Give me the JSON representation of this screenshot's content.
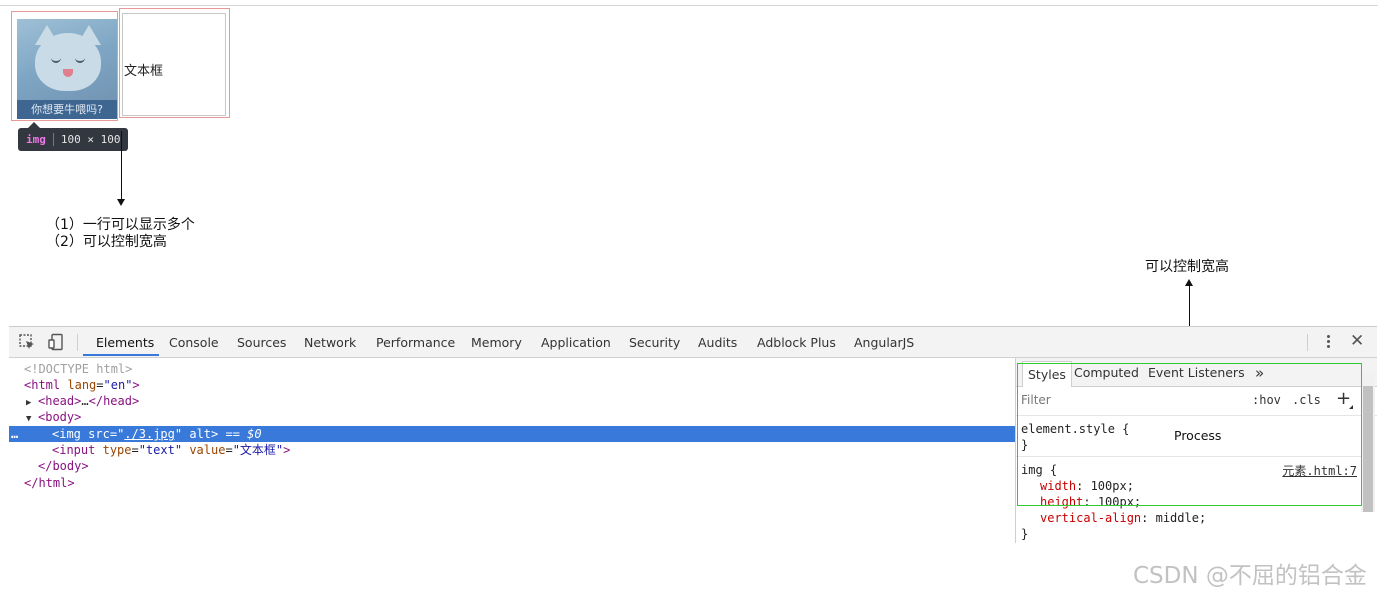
{
  "preview": {
    "image_caption": "你想要牛喂吗?",
    "input_value": "文本框",
    "tooltip_tag": "img",
    "tooltip_size": "100 × 100"
  },
  "notes": {
    "line1": "（1）一行可以显示多个",
    "line2": "（2）可以控制宽高",
    "right_label": "可以控制宽高",
    "process_label": "Process"
  },
  "devtools": {
    "tabs": [
      "Elements",
      "Console",
      "Sources",
      "Network",
      "Performance",
      "Memory",
      "Application",
      "Security",
      "Audits",
      "Adblock Plus",
      "AngularJS"
    ],
    "active_tab": "Elements",
    "dom": {
      "doctype": "<!DOCTYPE html>",
      "html_open_tag": "html",
      "html_lang_attr": "lang",
      "html_lang_val": "\"en\"",
      "head_tag": "head",
      "head_ellipsis": "…",
      "body_tag": "body",
      "img_tag": "img",
      "img_src_attr": "src",
      "img_src_val": "./3.jpg",
      "img_alt_attr": "alt",
      "img_selected_marker": "== $0",
      "input_tag": "input",
      "input_type_attr": "type",
      "input_type_val": "\"text\"",
      "input_value_attr": "value",
      "input_value_val": "\"文本框\"",
      "row_dots": "…"
    },
    "styles": {
      "sub_tabs": [
        "Styles",
        "Computed",
        "Event Listeners"
      ],
      "more_icon": "»",
      "filter_placeholder": "Filter",
      "hov": ":hov",
      "cls": ".cls",
      "add_rule_icon": "+",
      "element_style_selector": "element.style {",
      "close_brace": "}",
      "rule_selector": "img {",
      "rule_source": "元素.html:7",
      "declarations": [
        {
          "prop": "width",
          "val": "100px;"
        },
        {
          "prop": "height",
          "val": "100px;"
        },
        {
          "prop": "vertical-align",
          "val": "middle;"
        }
      ]
    }
  },
  "watermark": "CSDN @不屈的铝合金"
}
